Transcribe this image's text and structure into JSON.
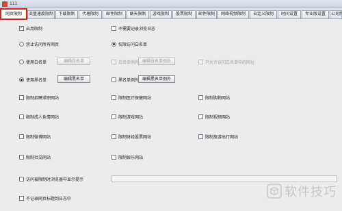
{
  "window": {
    "title": "111"
  },
  "tabs": [
    "网页限制",
    "流量速度限制",
    "下载限制",
    "代理限制",
    "邮件限制",
    "聊天限制",
    "游戏限制",
    "股票限制",
    "邮件限制",
    "网络视频限制",
    "自定义限制",
    "时间设置",
    "专业版设置",
    "公司制度本设置"
  ],
  "active_tab_index": 0,
  "options": {
    "web_limit": {
      "label": "启用限制",
      "checked": true
    },
    "no_log": {
      "label": "不需要记录浏览日志",
      "checked": false
    },
    "block_all": {
      "label": "禁止访问所有网页",
      "selected": false
    },
    "allow_all": {
      "label": "仅限访问白名单",
      "selected": true
    },
    "use_whitelist": {
      "label": "使用白名单",
      "selected": false
    },
    "edit_whitelist": {
      "label": "编辑白名单"
    },
    "whitelist_extra": {
      "label": "白名单例外",
      "checked": false
    },
    "edit_whitelist_extra": {
      "label": "编辑白名单例外"
    },
    "whitelist_note": {
      "label": "只允许访问白名单中的网址",
      "checked": false
    },
    "use_blacklist": {
      "label": "使用黑名单",
      "selected": true
    },
    "edit_blacklist": {
      "label": "编辑黑名单"
    },
    "blacklist_extra": {
      "label": "黑名单例外",
      "checked": false
    },
    "edit_blacklist_extra": {
      "label": "编辑黑名单例外"
    }
  },
  "categories": [
    {
      "label": "限制招聘求职网站",
      "checked": false
    },
    {
      "label": "限制医疗保健网站",
      "checked": false
    },
    {
      "label": "限制购物网站",
      "checked": false
    },
    {
      "label": "限制成人色情网站",
      "checked": false
    },
    {
      "label": "限制游戏网站",
      "checked": false
    },
    {
      "label": "限制视频网站",
      "checked": false
    },
    {
      "label": "限制微博网站",
      "checked": false
    },
    {
      "label": "限制财经股票网站",
      "checked": false
    },
    {
      "label": "限制旅游出行网站",
      "checked": false
    },
    {
      "label": "限制社交网站",
      "checked": false
    },
    {
      "label": "限制娱乐网站",
      "checked": false
    }
  ],
  "footer": {
    "show_notice": {
      "label": "访问被限制时浏览器中显示提示",
      "checked": false
    },
    "notice_value": "",
    "no_log_title": {
      "label": "不记录网页标题到日志中",
      "checked": false
    }
  },
  "watermark": {
    "text": "软件技巧",
    "icon": "box-logo-icon"
  }
}
